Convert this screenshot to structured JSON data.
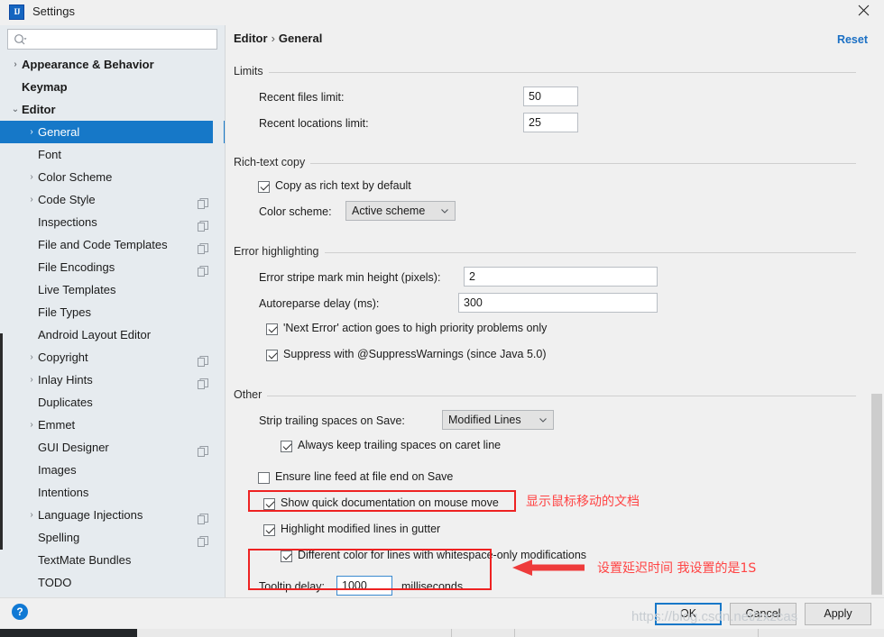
{
  "window": {
    "title": "Settings",
    "app_icon": "intellij-idea-icon",
    "close_icon": "close-icon"
  },
  "search": {
    "value": "",
    "placeholder": "",
    "icon": "search-icon"
  },
  "sidebar": {
    "items": [
      {
        "label": "Appearance & Behavior",
        "level": 0,
        "twisty": "chevron-right",
        "bold": true,
        "selected": false,
        "copyable": false
      },
      {
        "label": "Keymap",
        "level": 0,
        "twisty": "",
        "bold": true,
        "selected": false,
        "copyable": false
      },
      {
        "label": "Editor",
        "level": 0,
        "twisty": "chevron-down",
        "bold": true,
        "selected": false,
        "copyable": false
      },
      {
        "label": "General",
        "level": 1,
        "twisty": "chevron-right",
        "bold": false,
        "selected": true,
        "copyable": false
      },
      {
        "label": "Font",
        "level": 1,
        "twisty": "",
        "bold": false,
        "selected": false,
        "copyable": false
      },
      {
        "label": "Color Scheme",
        "level": 1,
        "twisty": "chevron-right",
        "bold": false,
        "selected": false,
        "copyable": false
      },
      {
        "label": "Code Style",
        "level": 1,
        "twisty": "chevron-right",
        "bold": false,
        "selected": false,
        "copyable": true
      },
      {
        "label": "Inspections",
        "level": 1,
        "twisty": "",
        "bold": false,
        "selected": false,
        "copyable": true
      },
      {
        "label": "File and Code Templates",
        "level": 1,
        "twisty": "",
        "bold": false,
        "selected": false,
        "copyable": true
      },
      {
        "label": "File Encodings",
        "level": 1,
        "twisty": "",
        "bold": false,
        "selected": false,
        "copyable": true
      },
      {
        "label": "Live Templates",
        "level": 1,
        "twisty": "",
        "bold": false,
        "selected": false,
        "copyable": false
      },
      {
        "label": "File Types",
        "level": 1,
        "twisty": "",
        "bold": false,
        "selected": false,
        "copyable": false
      },
      {
        "label": "Android Layout Editor",
        "level": 1,
        "twisty": "",
        "bold": false,
        "selected": false,
        "copyable": false
      },
      {
        "label": "Copyright",
        "level": 1,
        "twisty": "chevron-right",
        "bold": false,
        "selected": false,
        "copyable": true
      },
      {
        "label": "Inlay Hints",
        "level": 1,
        "twisty": "chevron-right",
        "bold": false,
        "selected": false,
        "copyable": true
      },
      {
        "label": "Duplicates",
        "level": 1,
        "twisty": "",
        "bold": false,
        "selected": false,
        "copyable": false
      },
      {
        "label": "Emmet",
        "level": 1,
        "twisty": "chevron-right",
        "bold": false,
        "selected": false,
        "copyable": false
      },
      {
        "label": "GUI Designer",
        "level": 1,
        "twisty": "",
        "bold": false,
        "selected": false,
        "copyable": true
      },
      {
        "label": "Images",
        "level": 1,
        "twisty": "",
        "bold": false,
        "selected": false,
        "copyable": false
      },
      {
        "label": "Intentions",
        "level": 1,
        "twisty": "",
        "bold": false,
        "selected": false,
        "copyable": false
      },
      {
        "label": "Language Injections",
        "level": 1,
        "twisty": "chevron-right",
        "bold": false,
        "selected": false,
        "copyable": true
      },
      {
        "label": "Spelling",
        "level": 1,
        "twisty": "",
        "bold": false,
        "selected": false,
        "copyable": true
      },
      {
        "label": "TextMate Bundles",
        "level": 1,
        "twisty": "",
        "bold": false,
        "selected": false,
        "copyable": false
      },
      {
        "label": "TODO",
        "level": 1,
        "twisty": "",
        "bold": false,
        "selected": false,
        "copyable": false
      }
    ]
  },
  "content": {
    "breadcrumb": {
      "parent": "Editor",
      "separator": "›",
      "current": "General"
    },
    "reset_label": "Reset",
    "limits": {
      "title": "Limits",
      "recent_files_label": "Recent files limit:",
      "recent_files_value": "50",
      "recent_locations_label": "Recent locations limit:",
      "recent_locations_value": "25"
    },
    "rich_text_copy": {
      "title": "Rich-text copy",
      "copy_as_rich_text_label": "Copy as rich text by default",
      "copy_as_rich_text_checked": true,
      "color_scheme_label": "Color scheme:",
      "color_scheme_value": "Active scheme"
    },
    "error_highlighting": {
      "title": "Error highlighting",
      "stripe_label": "Error stripe mark min height (pixels):",
      "stripe_value": "2",
      "autoreparse_label": "Autoreparse delay (ms):",
      "autoreparse_value": "300",
      "next_error_label": "'Next Error' action goes to high priority problems only",
      "next_error_checked": true,
      "suppress_label": "Suppress with @SuppressWarnings (since Java 5.0)",
      "suppress_checked": true
    },
    "other": {
      "title": "Other",
      "strip_trailing_label": "Strip trailing spaces on Save:",
      "strip_trailing_value": "Modified Lines",
      "always_keep_label": "Always keep trailing spaces on caret line",
      "always_keep_checked": true,
      "ensure_line_feed_label": "Ensure line feed at file end on Save",
      "ensure_line_feed_checked": false,
      "show_quick_doc_label": "Show quick documentation on mouse move",
      "show_quick_doc_checked": true,
      "highlight_modified_label": "Highlight modified lines in gutter",
      "highlight_modified_checked": true,
      "different_color_label": "Different color for lines with whitespace-only modifications",
      "different_color_checked": true,
      "tooltip_delay_label": "Tooltip delay:",
      "tooltip_delay_value": "1000",
      "tooltip_delay_units": "milliseconds"
    }
  },
  "annotations": [
    {
      "text": "显示鼠标移动的文档",
      "color": "#ff4444"
    },
    {
      "text": "设置延迟时间 我设置的是1S",
      "color": "#ff4444"
    }
  ],
  "footer": {
    "help_icon": "help-icon",
    "ok_label": "OK",
    "cancel_label": "Cancel",
    "apply_label": "Apply",
    "watermark": "https://blog.csdn.net/zxzcas"
  },
  "colors": {
    "accent": "#1678c8",
    "selection": "#1678c8",
    "annotation_red": "#ff4444",
    "redbox": "#ee2222",
    "link": "#1a6fc4"
  }
}
